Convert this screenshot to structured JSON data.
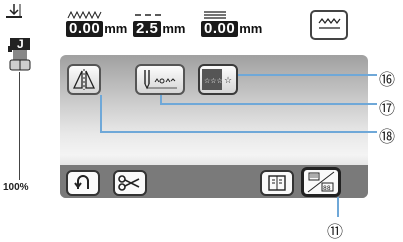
{
  "settings": {
    "stitch_width": {
      "icon": "zigzag-width-icon",
      "value": "0.00",
      "unit": "mm"
    },
    "stitch_length": {
      "icon": "stitch-length-icon",
      "value": "2.5",
      "unit": "mm"
    },
    "thread_tension": {
      "icon": "tension-icon",
      "value": "0.00",
      "unit": "mm"
    }
  },
  "presser_foot": {
    "letter": "J"
  },
  "speed": {
    "label": "100%"
  },
  "buttons": {
    "mirror": "mirror-image-icon",
    "twin_needle": "twin-needle-icon",
    "pattern_select": "pattern-preview-icon",
    "reverse": "reverse-icon",
    "cut": "scissors-icon",
    "book": "manual-icon",
    "page": "next-page-icon",
    "zigzag": "zigzag-icon"
  },
  "callouts": {
    "c16": "⑯",
    "c17": "⑰",
    "c18": "⑱",
    "c11": "⑪"
  },
  "colors": {
    "callout_line": "#6fa8d8",
    "value_box": "#1a1a1a"
  }
}
